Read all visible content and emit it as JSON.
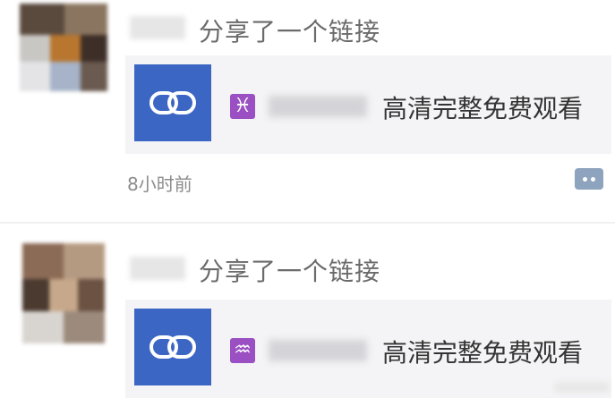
{
  "colors": {
    "link_thumb_bg": "#3c66c4",
    "zodiac_bg": "#9a4fc2",
    "card_bg": "#f4f4f6",
    "comment_button_bg": "#8ea3bd"
  },
  "posts": [
    {
      "share_text": "分享了一个链接",
      "link": {
        "icon": "chain-link-icon",
        "zodiac_symbol": "♓",
        "zodiac_icon": "pisces-icon",
        "title": "高清完整免费观看"
      },
      "time": "8小时前",
      "comment_icon": "comment-bubble-icon"
    },
    {
      "share_text": "分享了一个链接",
      "link": {
        "icon": "chain-link-icon",
        "zodiac_symbol": "♒",
        "zodiac_icon": "aquarius-icon",
        "title": "高清完整免费观看"
      }
    }
  ]
}
